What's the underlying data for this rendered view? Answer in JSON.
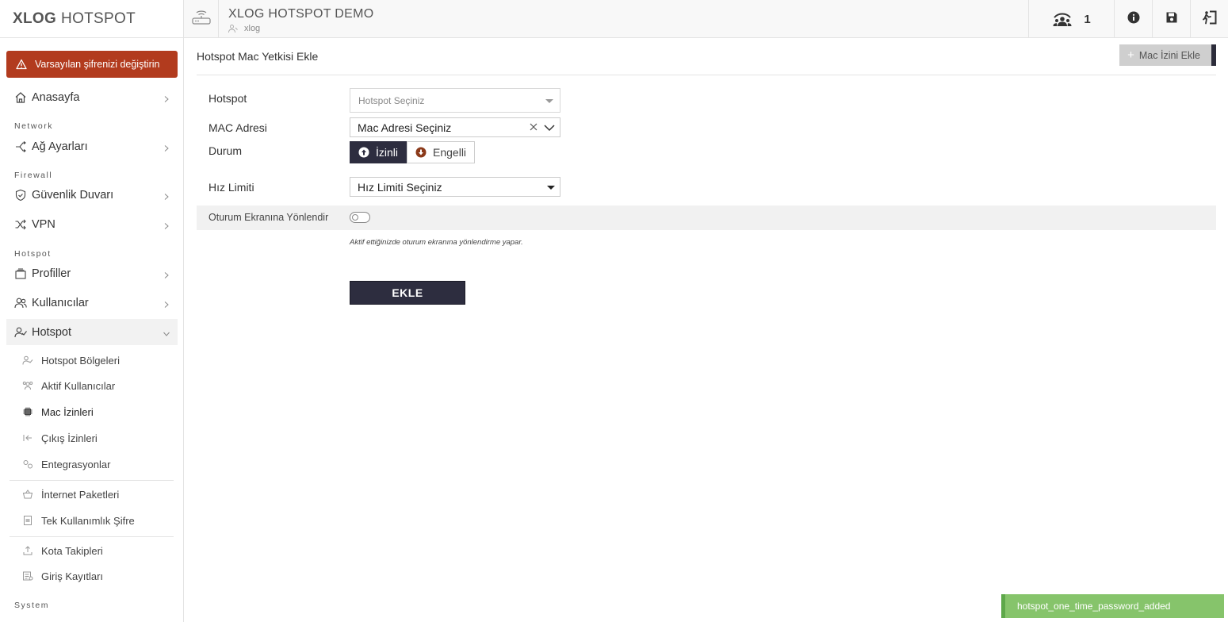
{
  "logo": {
    "bold": "XLOG",
    "light": "HOTSPOT"
  },
  "alert": {
    "text": "Varsayılan şifrenizi değiştirin"
  },
  "sidebar": {
    "home": "Anasayfa",
    "sections": {
      "network": "Network",
      "firewall": "Firewall",
      "hotspot": "Hotspot",
      "system": "System"
    },
    "network_settings": "Ağ Ayarları",
    "firewall": "Güvenlik Duvarı",
    "vpn": "VPN",
    "profiles": "Profiller",
    "users": "Kullanıcılar",
    "hotspot": "Hotspot",
    "sub": {
      "zones": "Hotspot Bölgeleri",
      "active_users": "Aktif Kullanıcılar",
      "mac_permissions": "Mac İzinleri",
      "exit_permissions": "Çıkış İzinleri",
      "integrations": "Entegrasyonlar",
      "internet_packages": "İnternet Paketleri",
      "one_time_password": "Tek Kullanımlık Şifre",
      "quota_tracking": "Kota Takipleri",
      "login_logs": "Giriş Kayıtları"
    }
  },
  "topbar": {
    "title": "XLOG HOTSPOT DEMO",
    "subtitle": "xlog",
    "user_count": "1"
  },
  "page": {
    "title": "Hotspot Mac Yetkisi Ekle",
    "add_button": "Mac İzini Ekle"
  },
  "form": {
    "hotspot_label": "Hotspot",
    "hotspot_placeholder": "Hotspot Seçiniz",
    "mac_label": "MAC Adresi",
    "mac_value": "Mac Adresi Seçiniz",
    "status_label": "Durum",
    "status_allowed": "İzinli",
    "status_blocked": "Engelli",
    "speed_label": "Hız Limiti",
    "speed_value": "Hız Limiti Seçiniz",
    "redirect_label": "Oturum Ekranına Yönlendir",
    "redirect_hint": "Aktif ettiğinizde oturum ekranına yönlendirme yapar.",
    "submit": "EKLE"
  },
  "toast": {
    "text": "hotspot_one_time_password_added"
  },
  "colors": {
    "alert": "#b23b1e",
    "primary": "#2d2d3f",
    "toast": "#86c46b"
  }
}
